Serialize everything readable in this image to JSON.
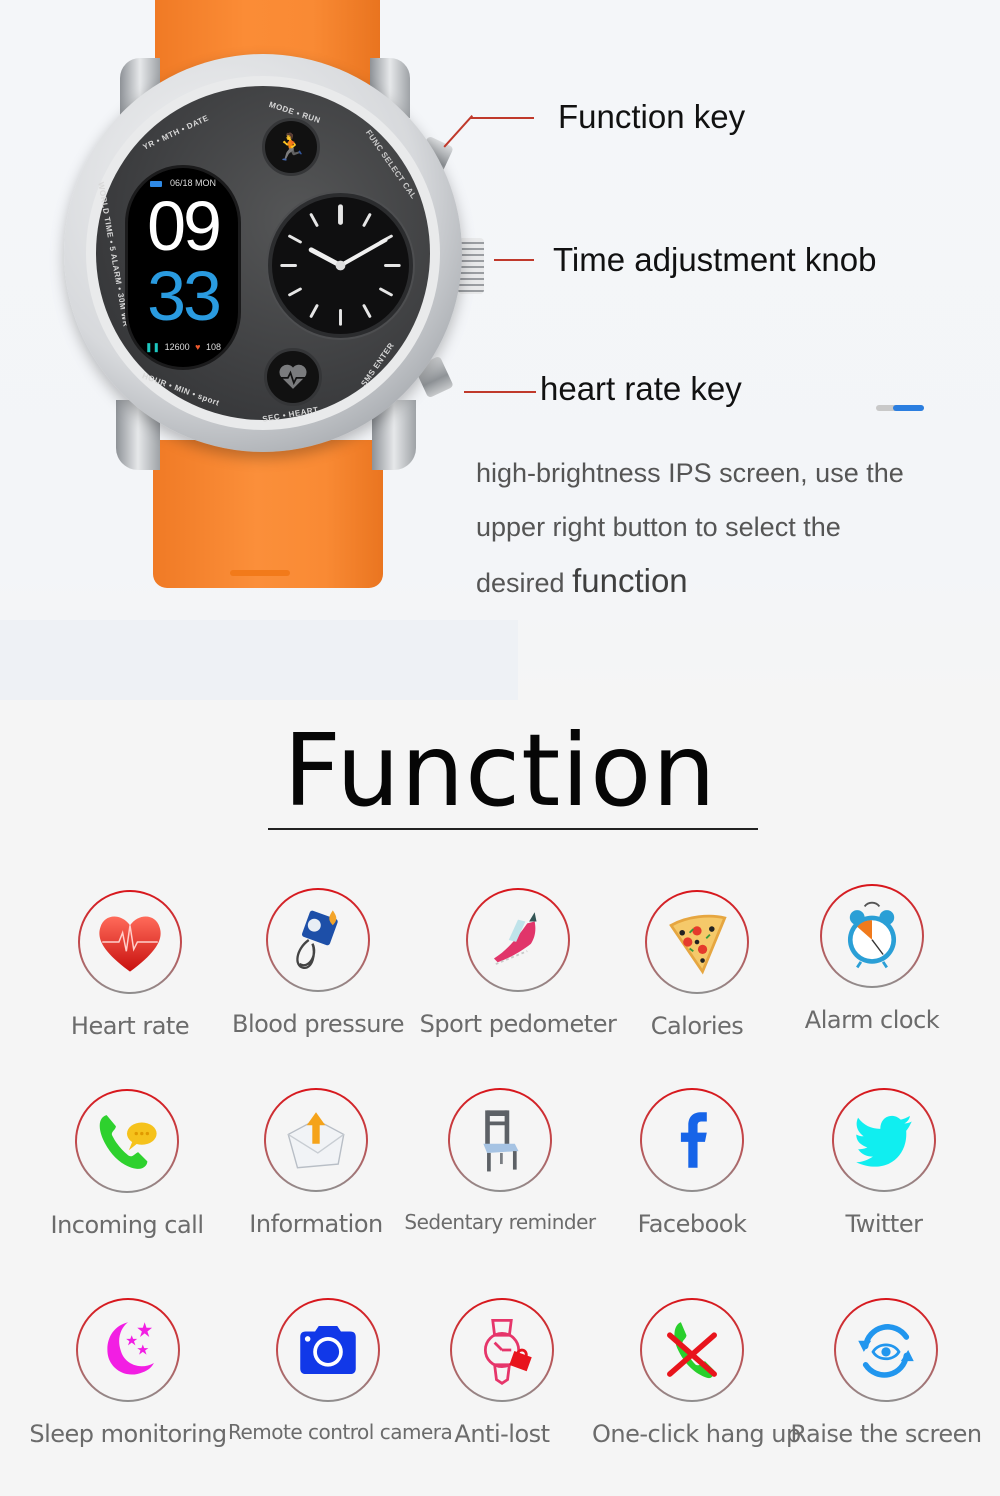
{
  "watch": {
    "screen": {
      "date": "06/18 MON",
      "hour": "09",
      "minute": "33",
      "steps": "12600",
      "heart_rate": "108"
    },
    "ring_labels": {
      "top": "YR • MTH • DATE",
      "left": "WORLD TIME • 5 ALARM • 30M WR",
      "bottom": "HOUR • MIN • sport",
      "mode": "MODE • RUN",
      "func": "FUNC SELECT CAL",
      "sms": "SMS ENTER",
      "sec": "SEC • HEART"
    }
  },
  "callouts": [
    {
      "label": "Function key"
    },
    {
      "label": "Time adjustment knob"
    },
    {
      "label": "heart rate key"
    }
  ],
  "pager": {
    "active_fraction": 0.65
  },
  "description": {
    "line1": "high-brightness IPS screen, use the",
    "line2": "upper right button to select the",
    "line3_prefix": "desired",
    "line3_emphasis": "function"
  },
  "section_title": "Function",
  "features": [
    {
      "label": "Heart rate",
      "icon": "heart-rate-icon"
    },
    {
      "label": "Blood pressure",
      "icon": "blood-pressure-icon"
    },
    {
      "label": "Sport pedometer",
      "icon": "running-shoe-icon"
    },
    {
      "label": "Calories",
      "icon": "pizza-icon"
    },
    {
      "label": "Alarm clock",
      "icon": "alarm-clock-icon"
    },
    {
      "label": "Incoming call",
      "icon": "phone-chat-icon"
    },
    {
      "label": "Information",
      "icon": "envelope-icon"
    },
    {
      "label": "Sedentary reminder",
      "icon": "chair-icon"
    },
    {
      "label": "Facebook",
      "icon": "facebook-icon"
    },
    {
      "label": "Twitter",
      "icon": "twitter-icon"
    },
    {
      "label": "Sleep monitoring",
      "icon": "moon-stars-icon"
    },
    {
      "label": "Remote control camera",
      "icon": "camera-icon"
    },
    {
      "label": "Anti-lost",
      "icon": "watch-lock-icon"
    },
    {
      "label": "One-click hang up",
      "icon": "hang-up-icon"
    },
    {
      "label": "Raise the screen",
      "icon": "eye-rotate-icon"
    }
  ],
  "colors": {
    "strap": "#f98a34",
    "callout_line": "#c0392b",
    "circle_border_top": "#d9141a",
    "accent_blue": "#2b7ee0"
  }
}
